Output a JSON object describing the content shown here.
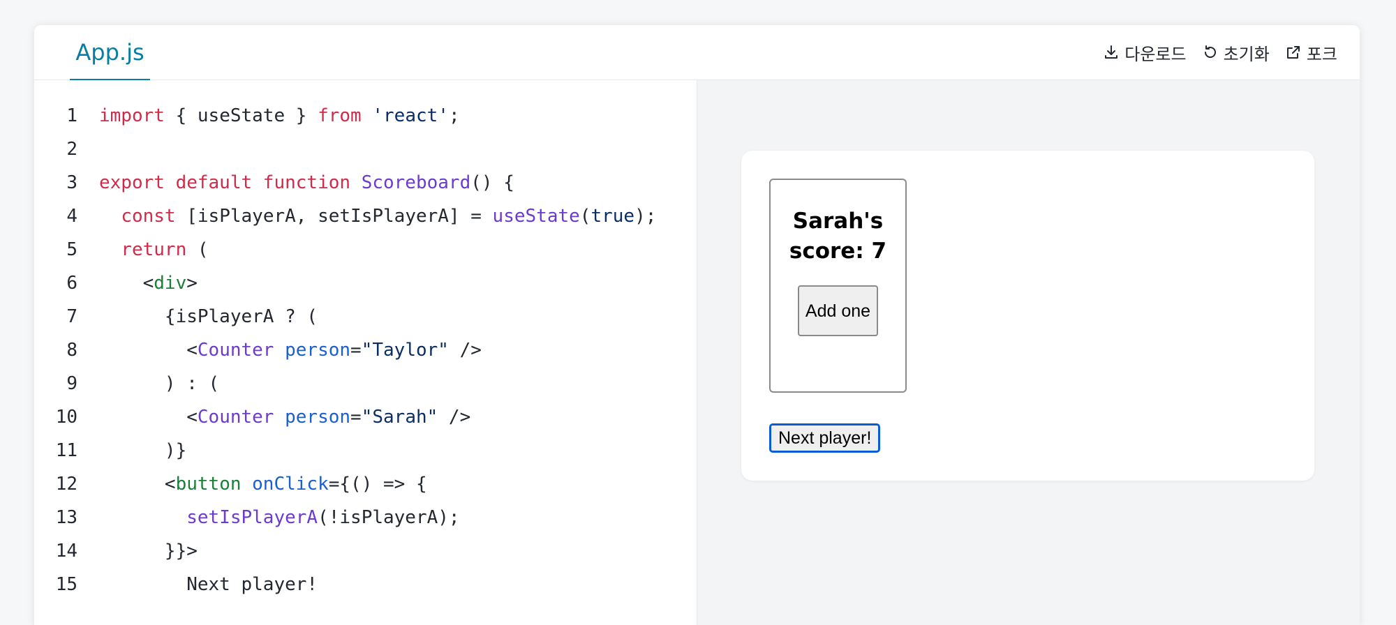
{
  "file_tab": "App.js",
  "actions": [
    {
      "icon": "download-icon",
      "label": "다운로드"
    },
    {
      "icon": "reset-icon",
      "label": "초기화"
    },
    {
      "icon": "external-link-icon",
      "label": "포크"
    }
  ],
  "code_lines": [
    [
      [
        "kw",
        "import"
      ],
      [
        "plain",
        " { useState } "
      ],
      [
        "kw",
        "from"
      ],
      [
        "plain",
        " "
      ],
      [
        "str",
        "'react'"
      ],
      [
        "plain",
        ";"
      ]
    ],
    [],
    [
      [
        "kw",
        "export default function"
      ],
      [
        "plain",
        " "
      ],
      [
        "fn",
        "Scoreboard"
      ],
      [
        "plain",
        "() {"
      ]
    ],
    [
      [
        "plain",
        "  "
      ],
      [
        "kw",
        "const"
      ],
      [
        "plain",
        " [isPlayerA, setIsPlayerA] = "
      ],
      [
        "fn",
        "useState"
      ],
      [
        "plain",
        "("
      ],
      [
        "str",
        "true"
      ],
      [
        "plain",
        ");"
      ]
    ],
    [
      [
        "plain",
        "  "
      ],
      [
        "kw",
        "return"
      ],
      [
        "plain",
        " ("
      ]
    ],
    [
      [
        "plain",
        "    <"
      ],
      [
        "tag",
        "div"
      ],
      [
        "plain",
        ">"
      ]
    ],
    [
      [
        "plain",
        "      {isPlayerA ? ("
      ]
    ],
    [
      [
        "plain",
        "        <"
      ],
      [
        "fn",
        "Counter"
      ],
      [
        "plain",
        " "
      ],
      [
        "attr",
        "person"
      ],
      [
        "plain",
        "="
      ],
      [
        "val",
        "\"Taylor\""
      ],
      [
        "plain",
        " />"
      ]
    ],
    [
      [
        "plain",
        "      ) : ("
      ]
    ],
    [
      [
        "plain",
        "        <"
      ],
      [
        "fn",
        "Counter"
      ],
      [
        "plain",
        " "
      ],
      [
        "attr",
        "person"
      ],
      [
        "plain",
        "="
      ],
      [
        "val",
        "\"Sarah\""
      ],
      [
        "plain",
        " />"
      ]
    ],
    [
      [
        "plain",
        "      )}"
      ]
    ],
    [
      [
        "plain",
        "      <"
      ],
      [
        "tag",
        "button"
      ],
      [
        "plain",
        " "
      ],
      [
        "attr",
        "onClick"
      ],
      [
        "plain",
        "={() => {"
      ]
    ],
    [
      [
        "plain",
        "        "
      ],
      [
        "fn",
        "setIsPlayerA"
      ],
      [
        "plain",
        "(!isPlayerA);"
      ]
    ],
    [
      [
        "plain",
        "      }}>"
      ]
    ],
    [
      [
        "plain",
        "        Next player!"
      ]
    ]
  ],
  "preview": {
    "score_text": "Sarah's score: 7",
    "add_button": "Add one",
    "next_button": "Next player!"
  },
  "colors": {
    "accent": "#087ea4",
    "keyword": "#d12b4b",
    "function": "#6b3bd1",
    "string": "#0b2d66",
    "tag": "#1a7f37",
    "attribute": "#1a5fd1"
  }
}
